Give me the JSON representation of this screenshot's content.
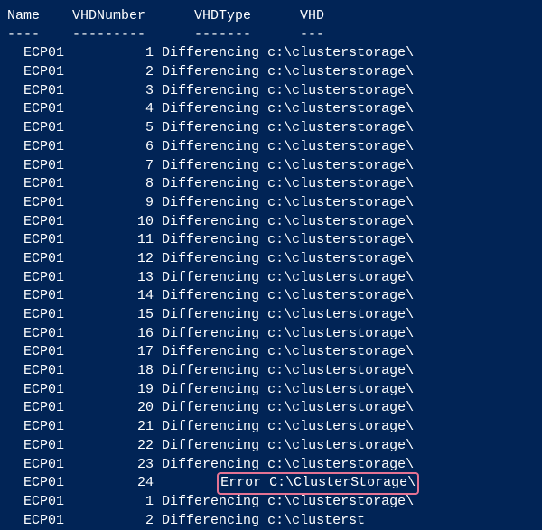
{
  "headers": {
    "name": "Name",
    "vhdNumber": "VHDNumber",
    "vhdType": "VHDType",
    "vhd": "VHD"
  },
  "dividers": {
    "name": "----",
    "vhdNumber": "---------",
    "vhdType": "-------",
    "vhd": "---"
  },
  "rows": [
    {
      "name": "ECP01",
      "num": "1",
      "type": "Differencing",
      "vhd": "c:\\clusterstorage\\",
      "highlight": false
    },
    {
      "name": "ECP01",
      "num": "2",
      "type": "Differencing",
      "vhd": "c:\\clusterstorage\\",
      "highlight": false
    },
    {
      "name": "ECP01",
      "num": "3",
      "type": "Differencing",
      "vhd": "c:\\clusterstorage\\",
      "highlight": false
    },
    {
      "name": "ECP01",
      "num": "4",
      "type": "Differencing",
      "vhd": "c:\\clusterstorage\\",
      "highlight": false
    },
    {
      "name": "ECP01",
      "num": "5",
      "type": "Differencing",
      "vhd": "c:\\clusterstorage\\",
      "highlight": false
    },
    {
      "name": "ECP01",
      "num": "6",
      "type": "Differencing",
      "vhd": "c:\\clusterstorage\\",
      "highlight": false
    },
    {
      "name": "ECP01",
      "num": "7",
      "type": "Differencing",
      "vhd": "c:\\clusterstorage\\",
      "highlight": false
    },
    {
      "name": "ECP01",
      "num": "8",
      "type": "Differencing",
      "vhd": "c:\\clusterstorage\\",
      "highlight": false
    },
    {
      "name": "ECP01",
      "num": "9",
      "type": "Differencing",
      "vhd": "c:\\clusterstorage\\",
      "highlight": false
    },
    {
      "name": "ECP01",
      "num": "10",
      "type": "Differencing",
      "vhd": "c:\\clusterstorage\\",
      "highlight": false
    },
    {
      "name": "ECP01",
      "num": "11",
      "type": "Differencing",
      "vhd": "c:\\clusterstorage\\",
      "highlight": false
    },
    {
      "name": "ECP01",
      "num": "12",
      "type": "Differencing",
      "vhd": "c:\\clusterstorage\\",
      "highlight": false
    },
    {
      "name": "ECP01",
      "num": "13",
      "type": "Differencing",
      "vhd": "c:\\clusterstorage\\",
      "highlight": false
    },
    {
      "name": "ECP01",
      "num": "14",
      "type": "Differencing",
      "vhd": "c:\\clusterstorage\\",
      "highlight": false
    },
    {
      "name": "ECP01",
      "num": "15",
      "type": "Differencing",
      "vhd": "c:\\clusterstorage\\",
      "highlight": false
    },
    {
      "name": "ECP01",
      "num": "16",
      "type": "Differencing",
      "vhd": "c:\\clusterstorage\\",
      "highlight": false
    },
    {
      "name": "ECP01",
      "num": "17",
      "type": "Differencing",
      "vhd": "c:\\clusterstorage\\",
      "highlight": false
    },
    {
      "name": "ECP01",
      "num": "18",
      "type": "Differencing",
      "vhd": "c:\\clusterstorage\\",
      "highlight": false
    },
    {
      "name": "ECP01",
      "num": "19",
      "type": "Differencing",
      "vhd": "c:\\clusterstorage\\",
      "highlight": false
    },
    {
      "name": "ECP01",
      "num": "20",
      "type": "Differencing",
      "vhd": "c:\\clusterstorage\\",
      "highlight": false
    },
    {
      "name": "ECP01",
      "num": "21",
      "type": "Differencing",
      "vhd": "c:\\clusterstorage\\",
      "highlight": false
    },
    {
      "name": "ECP01",
      "num": "22",
      "type": "Differencing",
      "vhd": "c:\\clusterstorage\\",
      "highlight": false
    },
    {
      "name": "ECP01",
      "num": "23",
      "type": "Differencing",
      "vhd": "c:\\clusterstorage\\",
      "highlight": false
    },
    {
      "name": "ECP01",
      "num": "24",
      "type": "",
      "vhd": "Error C:\\ClusterStorage\\",
      "highlight": true
    },
    {
      "name": "ECP01",
      "num": "1",
      "type": "Differencing",
      "vhd": "c:\\clusterstorage\\",
      "highlight": false
    },
    {
      "name": "ECP01",
      "num": "2",
      "type": "Differencing",
      "vhd": "c:\\clusterst",
      "highlight": false
    }
  ]
}
